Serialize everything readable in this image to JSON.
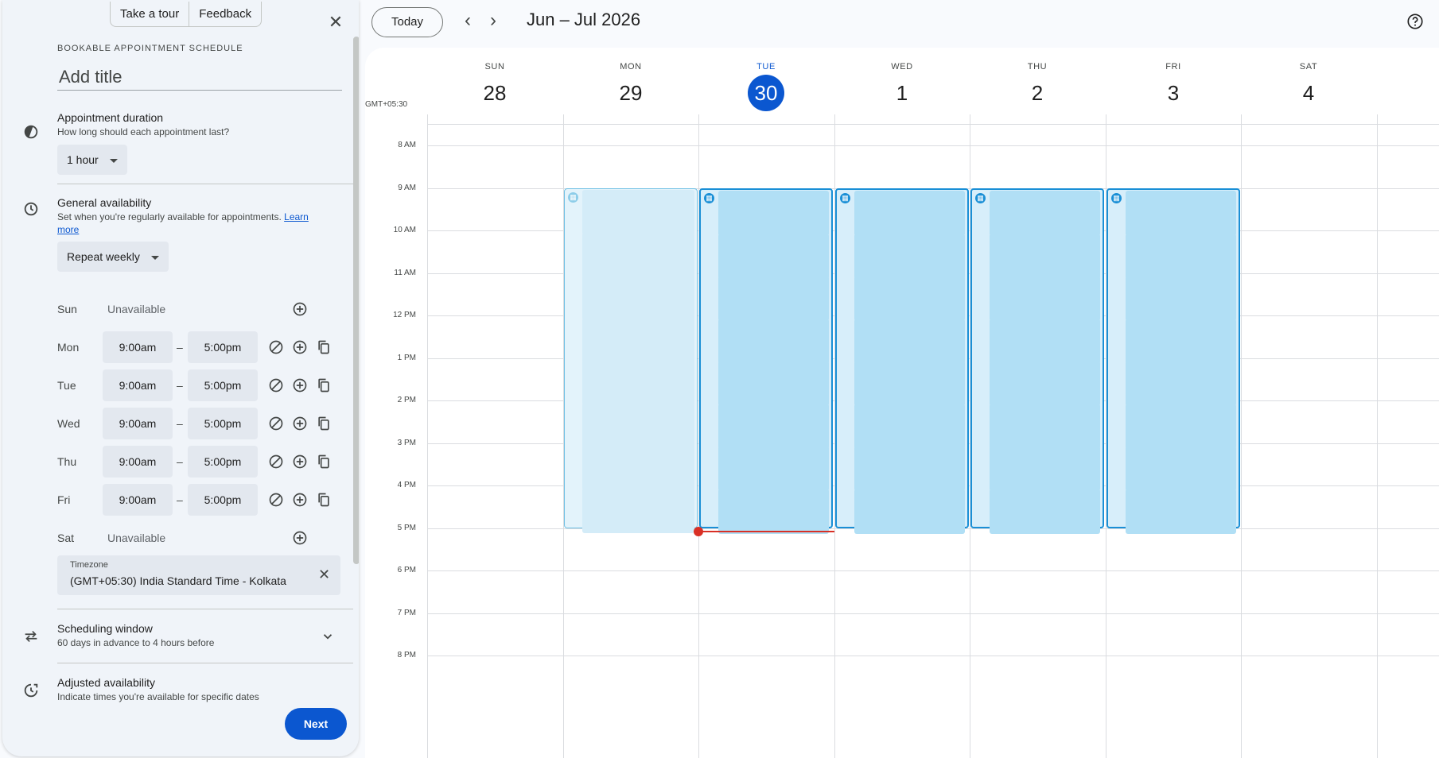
{
  "panel": {
    "tour_label": "Take a tour",
    "feedback_label": "Feedback",
    "eyebrow": "BOOKABLE APPOINTMENT SCHEDULE",
    "title_placeholder": "Add title",
    "duration": {
      "heading": "Appointment duration",
      "sub": "How long should each appointment last?",
      "value": "1 hour"
    },
    "availability": {
      "heading": "General availability",
      "sub": "Set when you're regularly available for appointments.",
      "learn_more": "Learn more",
      "repeat": "Repeat weekly",
      "unavailable_label": "Unavailable",
      "dash": "–",
      "days": [
        {
          "label": "Sun",
          "available": false
        },
        {
          "label": "Mon",
          "available": true,
          "start": "9:00am",
          "end": "5:00pm"
        },
        {
          "label": "Tue",
          "available": true,
          "start": "9:00am",
          "end": "5:00pm"
        },
        {
          "label": "Wed",
          "available": true,
          "start": "9:00am",
          "end": "5:00pm"
        },
        {
          "label": "Thu",
          "available": true,
          "start": "9:00am",
          "end": "5:00pm"
        },
        {
          "label": "Fri",
          "available": true,
          "start": "9:00am",
          "end": "5:00pm"
        },
        {
          "label": "Sat",
          "available": false
        }
      ]
    },
    "timezone": {
      "label": "Timezone",
      "value": "(GMT+05:30) India Standard Time - Kolkata"
    },
    "scheduling_window": {
      "heading": "Scheduling window",
      "sub": "60 days in advance to 4 hours before"
    },
    "adjusted": {
      "heading": "Adjusted availability",
      "sub": "Indicate times you're available for specific dates"
    },
    "next_label": "Next"
  },
  "toolbar": {
    "today_label": "Today",
    "range_title": "Jun – Jul 2026"
  },
  "calendar": {
    "timezone_note": "GMT+05:30",
    "days": [
      {
        "dow": "SUN",
        "num": "28"
      },
      {
        "dow": "MON",
        "num": "29"
      },
      {
        "dow": "TUE",
        "num": "30",
        "today": true
      },
      {
        "dow": "WED",
        "num": "1"
      },
      {
        "dow": "THU",
        "num": "2"
      },
      {
        "dow": "FRI",
        "num": "3"
      },
      {
        "dow": "SAT",
        "num": "4"
      }
    ],
    "hours": [
      "8 AM",
      "9 AM",
      "10 AM",
      "11 AM",
      "12 PM",
      "1 PM",
      "2 PM",
      "3 PM",
      "4 PM",
      "5 PM",
      "6 PM",
      "7 PM",
      "8 PM"
    ],
    "slots_per_day": 8,
    "colors": {
      "accent": "#0b57d0",
      "slot_border": "#1a8fd6",
      "slot_fill": "#b1dff5",
      "now": "#d93025"
    }
  }
}
